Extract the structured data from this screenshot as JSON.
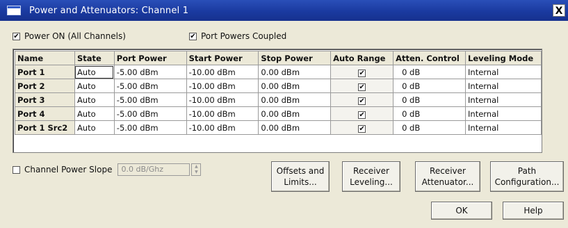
{
  "window": {
    "title": "Power and Attenuators: Channel 1",
    "close_label": "X"
  },
  "options": {
    "power_on": {
      "label": "Power ON (All Channels)",
      "checked": true
    },
    "coupled": {
      "label": "Port Powers Coupled",
      "checked": true
    },
    "check_mark": "✔"
  },
  "table": {
    "headers": [
      "Name",
      "State",
      "Port Power",
      "Start Power",
      "Stop Power",
      "Auto Range",
      "Atten. Control",
      "Leveling Mode"
    ],
    "rows": [
      {
        "name": "Port 1",
        "state": "Auto",
        "port_power": "-5.00 dBm",
        "start_power": "-10.00 dBm",
        "stop_power": "0.00 dBm",
        "auto_range": true,
        "atten": "0 dB",
        "leveling": "Internal"
      },
      {
        "name": "Port 2",
        "state": "Auto",
        "port_power": "-5.00 dBm",
        "start_power": "-10.00 dBm",
        "stop_power": "0.00 dBm",
        "auto_range": true,
        "atten": "0 dB",
        "leveling": "Internal"
      },
      {
        "name": "Port 3",
        "state": "Auto",
        "port_power": "-5.00 dBm",
        "start_power": "-10.00 dBm",
        "stop_power": "0.00 dBm",
        "auto_range": true,
        "atten": "0 dB",
        "leveling": "Internal"
      },
      {
        "name": "Port 4",
        "state": "Auto",
        "port_power": "-5.00 dBm",
        "start_power": "-10.00 dBm",
        "stop_power": "0.00 dBm",
        "auto_range": true,
        "atten": "0 dB",
        "leveling": "Internal"
      },
      {
        "name": "Port 1 Src2",
        "state": "Auto",
        "port_power": "-5.00 dBm",
        "start_power": "-10.00 dBm",
        "stop_power": "0.00 dBm",
        "auto_range": true,
        "atten": "0 dB",
        "leveling": "Internal"
      }
    ]
  },
  "slope": {
    "label": "Channel Power Slope",
    "checked": false,
    "value": "0.0 dB/Ghz"
  },
  "buttons": {
    "offsets": "Offsets and\nLimits...",
    "receiver_leveling": "Receiver\nLeveling...",
    "receiver_attenuator": "Receiver\nAttenuator...",
    "path_config": "Path\nConfiguration...",
    "ok": "OK",
    "help": "Help"
  }
}
